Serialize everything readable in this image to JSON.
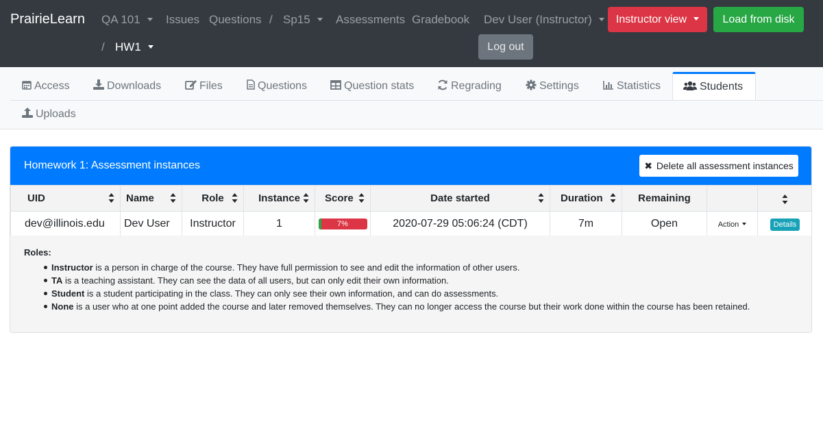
{
  "navbar": {
    "brand": "PrairieLearn",
    "course": "QA 101",
    "issues": "Issues",
    "questions": "Questions",
    "separator": "/",
    "semester": "Sp15",
    "assessments": "Assessments",
    "gradebook": "Gradebook",
    "user": "Dev User (Instructor)",
    "instructor_view": "Instructor view",
    "load_from_disk": "Load from disk",
    "assessment": "HW1",
    "logout": "Log out"
  },
  "tabs": [
    {
      "label": "Access",
      "icon": "calendar-icon"
    },
    {
      "label": "Downloads",
      "icon": "download-icon"
    },
    {
      "label": "Files",
      "icon": "edit-icon"
    },
    {
      "label": "Questions",
      "icon": "file-icon"
    },
    {
      "label": "Question stats",
      "icon": "table-icon"
    },
    {
      "label": "Regrading",
      "icon": "sync-icon"
    },
    {
      "label": "Settings",
      "icon": "gear-icon"
    },
    {
      "label": "Statistics",
      "icon": "chart-icon"
    },
    {
      "label": "Students",
      "icon": "users-icon",
      "active": true
    },
    {
      "label": "Uploads",
      "icon": "upload-icon"
    }
  ],
  "card": {
    "title": "Homework 1: Assessment instances",
    "delete_all": "Delete all assessment instances"
  },
  "table": {
    "headers": [
      "UID",
      "Name",
      "Role",
      "Instance",
      "Score",
      "Date started",
      "Duration",
      "Remaining",
      "",
      ""
    ],
    "rows": [
      {
        "uid": "dev@illinois.edu",
        "name": "Dev User",
        "role": "Instructor",
        "instance": "1",
        "score": "7%",
        "score_fraction": 0.07,
        "date_started": "2020-07-29 05:06:24 (CDT)",
        "duration": "7m",
        "remaining": "Open",
        "action": "Action",
        "details": "Details"
      }
    ]
  },
  "roles": {
    "title": "Roles:",
    "items": [
      {
        "name": "Instructor",
        "text": " is a person in charge of the course. They have full permission to see and edit the information of other users."
      },
      {
        "name": "TA",
        "text": " is a teaching assistant. They can see the data of all users, but can only edit their own information."
      },
      {
        "name": "Student",
        "text": " is a student participating in the class. They can only see their own information, and can do assessments."
      },
      {
        "name": "None",
        "text": " is a user who at one point added the course and later removed themselves. They can no longer access the course but their work done within the course has been retained."
      }
    ]
  },
  "colors": {
    "navbar": "#343a40",
    "primary": "#007bff",
    "danger": "#dc3545",
    "success": "#28a745",
    "info": "#17a2b8"
  }
}
